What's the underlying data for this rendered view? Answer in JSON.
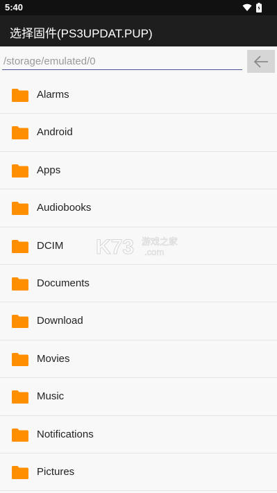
{
  "status_bar": {
    "time": "5:40",
    "icons": [
      "wifi-icon",
      "battery-icon"
    ]
  },
  "app_bar": {
    "title": "选择固件(PS3UPDAT.PUP)"
  },
  "path_bar": {
    "path": "/storage/emulated/0",
    "back_icon": "arrow-left-icon"
  },
  "folders": [
    {
      "name": "Alarms"
    },
    {
      "name": "Android"
    },
    {
      "name": "Apps"
    },
    {
      "name": "Audiobooks"
    },
    {
      "name": "DCIM"
    },
    {
      "name": "Documents"
    },
    {
      "name": "Download"
    },
    {
      "name": "Movies"
    },
    {
      "name": "Music"
    },
    {
      "name": "Notifications"
    },
    {
      "name": "Pictures"
    }
  ],
  "watermark": {
    "brand": "K73",
    "text": "游戏之家",
    "suffix": ".com"
  },
  "colors": {
    "folder": "#ff8f00",
    "status_bar": "#111111",
    "app_bar": "#1e1e1e",
    "underline": "#4a4f8f"
  }
}
